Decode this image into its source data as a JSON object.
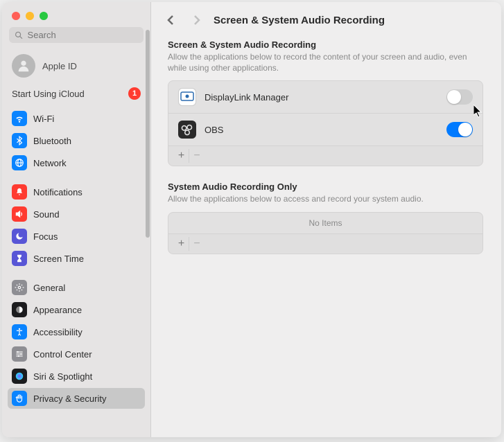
{
  "header": {
    "title": "Screen & System Audio Recording"
  },
  "search": {
    "placeholder": "Search"
  },
  "apple_id": {
    "label": "Apple ID"
  },
  "icloud": {
    "label": "Start Using iCloud",
    "badge": "1"
  },
  "sidebar": {
    "groups": [
      [
        {
          "label": "Wi-Fi",
          "icon": "wifi",
          "color": "#0a84ff"
        },
        {
          "label": "Bluetooth",
          "icon": "bluetooth",
          "color": "#0a84ff"
        },
        {
          "label": "Network",
          "icon": "network",
          "color": "#0a84ff"
        }
      ],
      [
        {
          "label": "Notifications",
          "icon": "bell",
          "color": "#ff3b30"
        },
        {
          "label": "Sound",
          "icon": "sound",
          "color": "#ff3b30"
        },
        {
          "label": "Focus",
          "icon": "moon",
          "color": "#5856d6"
        },
        {
          "label": "Screen Time",
          "icon": "hourglass",
          "color": "#5856d6"
        }
      ],
      [
        {
          "label": "General",
          "icon": "gear",
          "color": "#8e8e93"
        },
        {
          "label": "Appearance",
          "icon": "appearance",
          "color": "#1c1c1e"
        },
        {
          "label": "Accessibility",
          "icon": "accessibility",
          "color": "#0a84ff"
        },
        {
          "label": "Control Center",
          "icon": "sliders",
          "color": "#8e8e93"
        },
        {
          "label": "Siri & Spotlight",
          "icon": "siri",
          "color": "#1c1c1e"
        },
        {
          "label": "Privacy & Security",
          "icon": "hand",
          "color": "#0a84ff",
          "selected": true
        }
      ]
    ]
  },
  "sections": {
    "screen": {
      "title": "Screen & System Audio Recording",
      "desc": "Allow the applications below to record the content of your screen and audio, even while using other applications.",
      "apps": [
        {
          "name": "DisplayLink Manager",
          "icon": "displaylink",
          "enabled": false
        },
        {
          "name": "OBS",
          "icon": "obs",
          "enabled": true
        }
      ]
    },
    "audio": {
      "title": "System Audio Recording Only",
      "desc": "Allow the applications below to access and record your system audio.",
      "empty": "No Items"
    }
  },
  "footer": {
    "add": "+",
    "remove": "−"
  }
}
